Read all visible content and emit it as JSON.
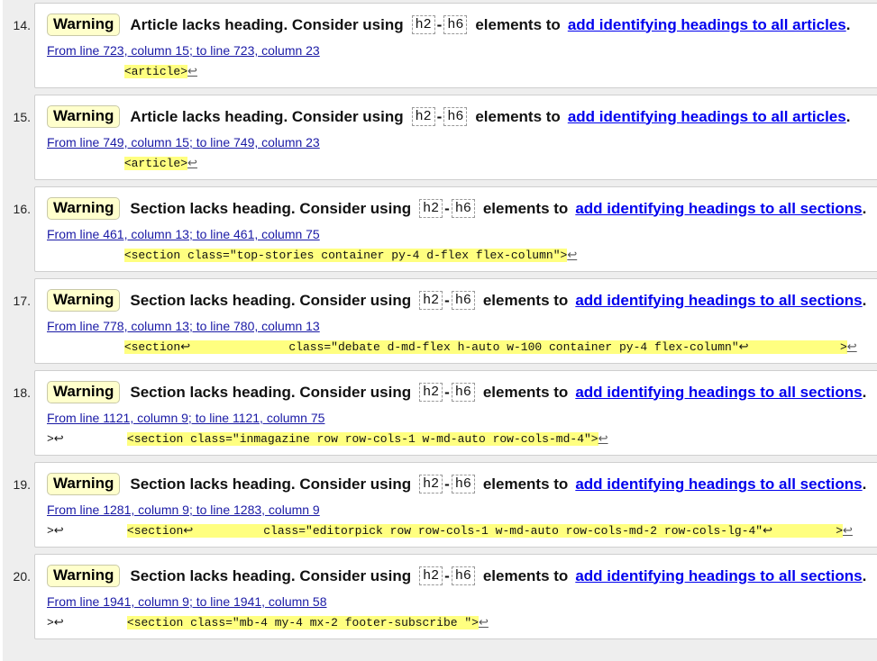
{
  "items": [
    {
      "number": "14.",
      "badge": "Warning",
      "message": "Article lacks heading. Consider using",
      "code_start": "h2",
      "dash": "-",
      "code_end": "h6",
      "message_mid": "elements to",
      "link": "add identifying headings to all articles",
      "period": ".",
      "location": "From line 723, column 15; to line 723, column 23",
      "extract_pre": "           ",
      "extract_hl": "<article>",
      "extract_post": "↩"
    },
    {
      "number": "15.",
      "badge": "Warning",
      "message": "Article lacks heading. Consider using",
      "code_start": "h2",
      "dash": "-",
      "code_end": "h6",
      "message_mid": "elements to",
      "link": "add identifying headings to all articles",
      "period": ".",
      "location": "From line 749, column 15; to line 749, column 23",
      "extract_pre": "           ",
      "extract_hl": "<article>",
      "extract_post": "↩"
    },
    {
      "number": "16.",
      "badge": "Warning",
      "message": "Section lacks heading. Consider using",
      "code_start": "h2",
      "dash": "-",
      "code_end": "h6",
      "message_mid": "elements to",
      "link": "add identifying headings to all sections",
      "period": ".",
      "location": "From line 461, column 13; to line 461, column 75",
      "extract_pre": "           ",
      "extract_hl": "<section class=\"top-stories container py-4 d-flex flex-column\">",
      "extract_post": "↩"
    },
    {
      "number": "17.",
      "badge": "Warning",
      "message": "Section lacks heading. Consider using",
      "code_start": "h2",
      "dash": "-",
      "code_end": "h6",
      "message_mid": "elements to",
      "link": "add identifying headings to all sections",
      "period": ".",
      "location": "From line 778, column 13; to line 780, column 13",
      "extract_pre": "           ",
      "extract_hl": "<section↩              class=\"debate d-md-flex h-auto w-100 container py-4 flex-column\"↩             >",
      "extract_post": "↩"
    },
    {
      "number": "18.",
      "badge": "Warning",
      "message": "Section lacks heading. Consider using",
      "code_start": "h2",
      "dash": "-",
      "code_end": "h6",
      "message_mid": "elements to",
      "link": "add identifying headings to all sections",
      "period": ".",
      "location": "From line 1121, column 9; to line 1121, column 75",
      "extract_pre": ">↩         ",
      "extract_hl": "<section class=\"inmagazine row row-cols-1 w-md-auto row-cols-md-4\">",
      "extract_post": "↩"
    },
    {
      "number": "19.",
      "badge": "Warning",
      "message": "Section lacks heading. Consider using",
      "code_start": "h2",
      "dash": "-",
      "code_end": "h6",
      "message_mid": "elements to",
      "link": "add identifying headings to all sections",
      "period": ".",
      "location": "From line 1281, column 9; to line 1283, column 9",
      "extract_pre": ">↩         ",
      "extract_hl": "<section↩          class=\"editorpick row row-cols-1 w-md-auto row-cols-md-2 row-cols-lg-4\"↩         >",
      "extract_post": "↩"
    },
    {
      "number": "20.",
      "badge": "Warning",
      "message": "Section lacks heading. Consider using",
      "code_start": "h2",
      "dash": "-",
      "code_end": "h6",
      "message_mid": "elements to",
      "link": "add identifying headings to all sections",
      "period": ".",
      "location": "From line 1941, column 9; to line 1941, column 58",
      "extract_pre": ">↩         ",
      "extract_hl": "<section class=\"mb-4 my-4 mx-2 footer-subscribe \">",
      "extract_post": "↩"
    }
  ]
}
